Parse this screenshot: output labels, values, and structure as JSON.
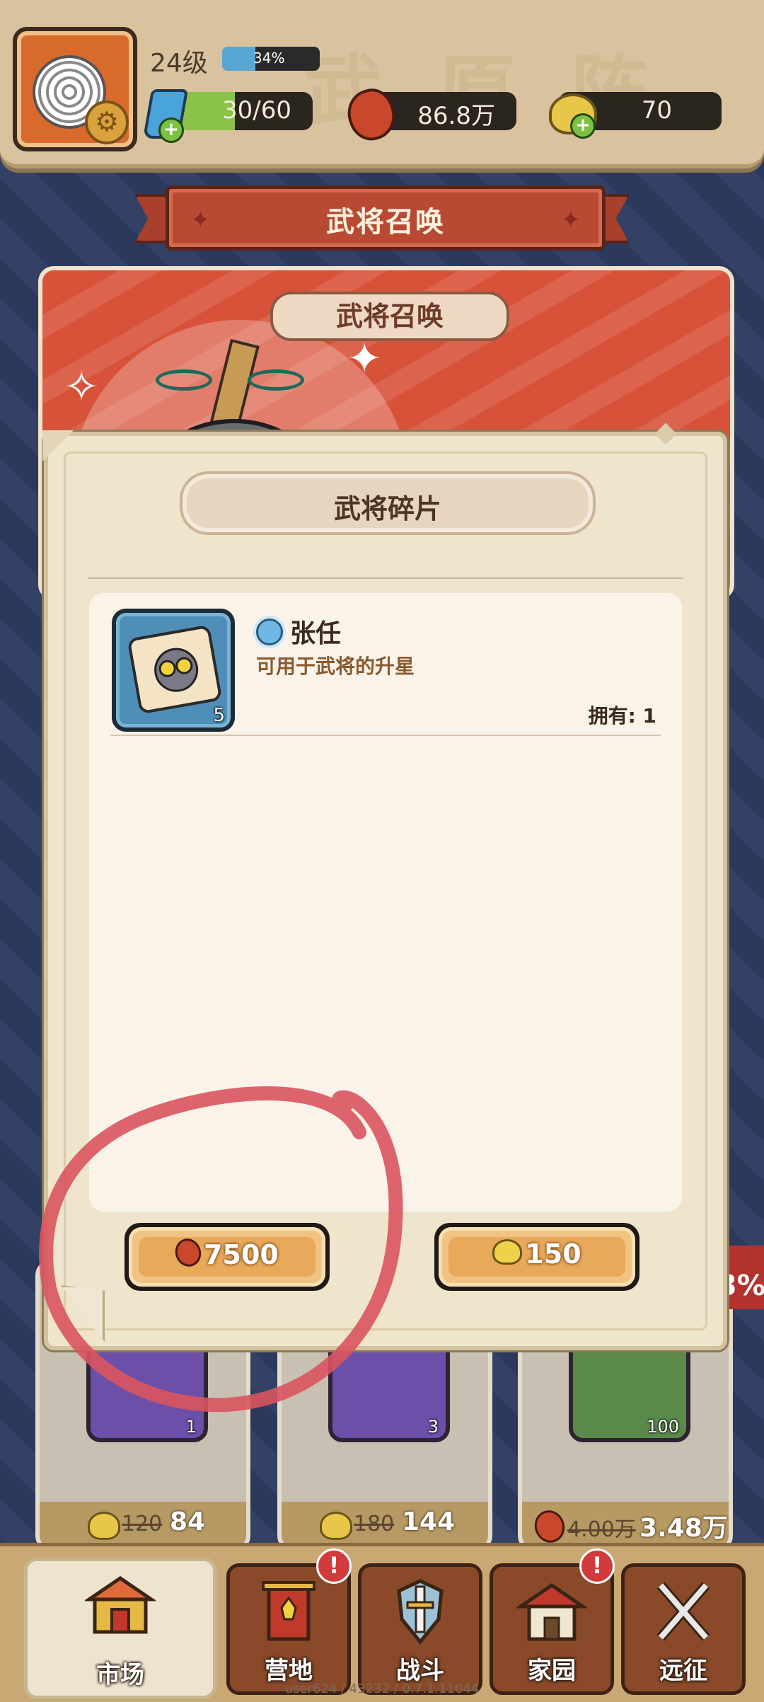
{
  "hud": {
    "level": "24级",
    "xp_percent_label": "34%",
    "xp_fraction": 0.34,
    "energy": "30/60",
    "beans": "86.8万",
    "buns": "70"
  },
  "banner": {
    "title": "武将召唤"
  },
  "summon_card": {
    "title": "武将召唤"
  },
  "modal": {
    "title": "武将碎片",
    "item": {
      "name": "张任",
      "description": "可用于武将的升星",
      "quantity": "5",
      "owned": "拥有: 1"
    },
    "buy_beans": {
      "price": "7500",
      "currency_icon": "bean-icon"
    },
    "buy_buns": {
      "price": "150",
      "currency_icon": "bun-icon"
    }
  },
  "shop": {
    "cards": [
      {
        "qty": "1",
        "old_price": "120",
        "new_price": "84",
        "currency_icon": "bun-icon"
      },
      {
        "qty": "3",
        "old_price": "180",
        "new_price": "144",
        "currency_icon": "bun-icon"
      },
      {
        "qty": "100",
        "old_price": "4.00万",
        "new_price": "3.48万",
        "currency_icon": "bean-icon"
      }
    ],
    "discount_partial": "3%"
  },
  "nav": {
    "items": [
      {
        "label": "市场",
        "icon": "market-icon",
        "active": true,
        "alert": false
      },
      {
        "label": "营地",
        "icon": "camp-icon",
        "active": false,
        "alert": true
      },
      {
        "label": "战斗",
        "icon": "battle-icon",
        "active": false,
        "alert": false
      },
      {
        "label": "家园",
        "icon": "home-icon",
        "active": false,
        "alert": true
      },
      {
        "label": "远征",
        "icon": "expedition-icon",
        "active": false,
        "alert": false
      }
    ],
    "alert_mark": "!"
  },
  "footer": {
    "version": "user624 / 43232 / 0.7.1.11044"
  },
  "colors": {
    "annotation_circle": "#d9545e",
    "modal_bg": "#efe4cc",
    "button_orange": "#e8a95a"
  }
}
